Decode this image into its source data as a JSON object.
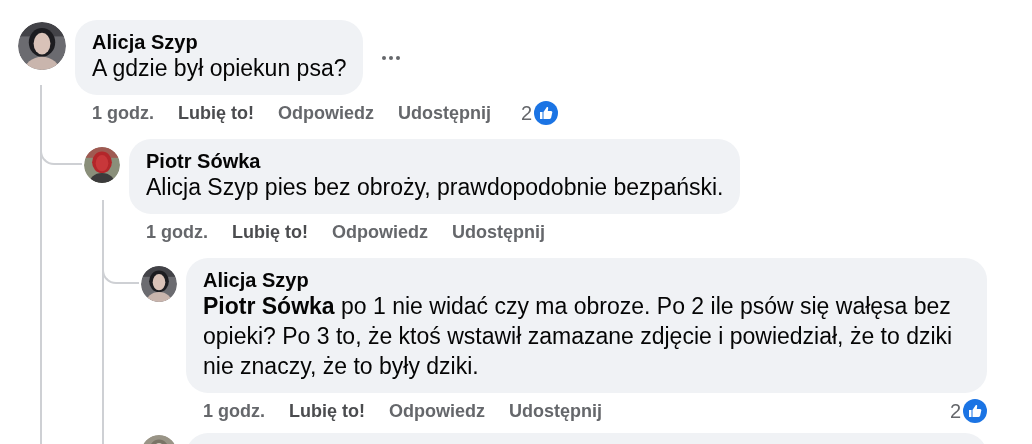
{
  "comments": [
    {
      "author": "Alicja Szyp",
      "avatar": {
        "kind": "picture"
      },
      "text": "A gdzie był opiekun psa?",
      "has_menu": true,
      "time": "1 godz.",
      "actions": [
        {
          "label": "Lubię to!",
          "kind": "like"
        },
        {
          "label": "Odpowiedz",
          "kind": "reply"
        },
        {
          "label": "Udostępnij",
          "kind": "share"
        }
      ],
      "reactions": "2",
      "children": [
        {
          "author": "Piotr Sówka",
          "avatar": {
            "kind": "picture"
          },
          "text": "Alicja Szyp pies bez obroży, prawdopodobnie bezpański.",
          "time": "1 godz.",
          "actions": [
            {
              "label": "Lubię to!",
              "kind": "like"
            },
            {
              "label": "Odpowiedz",
              "kind": "reply"
            },
            {
              "label": "Udostępnij",
              "kind": "share"
            }
          ],
          "children": [
            {
              "author": "Alicja Szyp",
              "avatar": {
                "kind": "picture"
              },
              "text": "**Piotr Sówka** po 1 nie widać czy ma obroze. Po 2 ile psów się wałęsa bez opieki? Po 3 to, że ktoś wstawił zamazane zdjęcie i powiedział, że to dziki nie znaczy, że to były dziki.",
              "time": "1 godz.",
              "actions": [
                {
                  "label": "Lubię to!",
                  "kind": "like"
                },
                {
                  "label": "Odpowiedz",
                  "kind": "reply"
                },
                {
                  "label": "Udostępnij",
                  "kind": "share"
                }
              ],
              "reactions": "2"
            },
            {
              "avatar": {
                "kind": "picture"
              }
            }
          ]
        }
      ]
    }
  ]
}
